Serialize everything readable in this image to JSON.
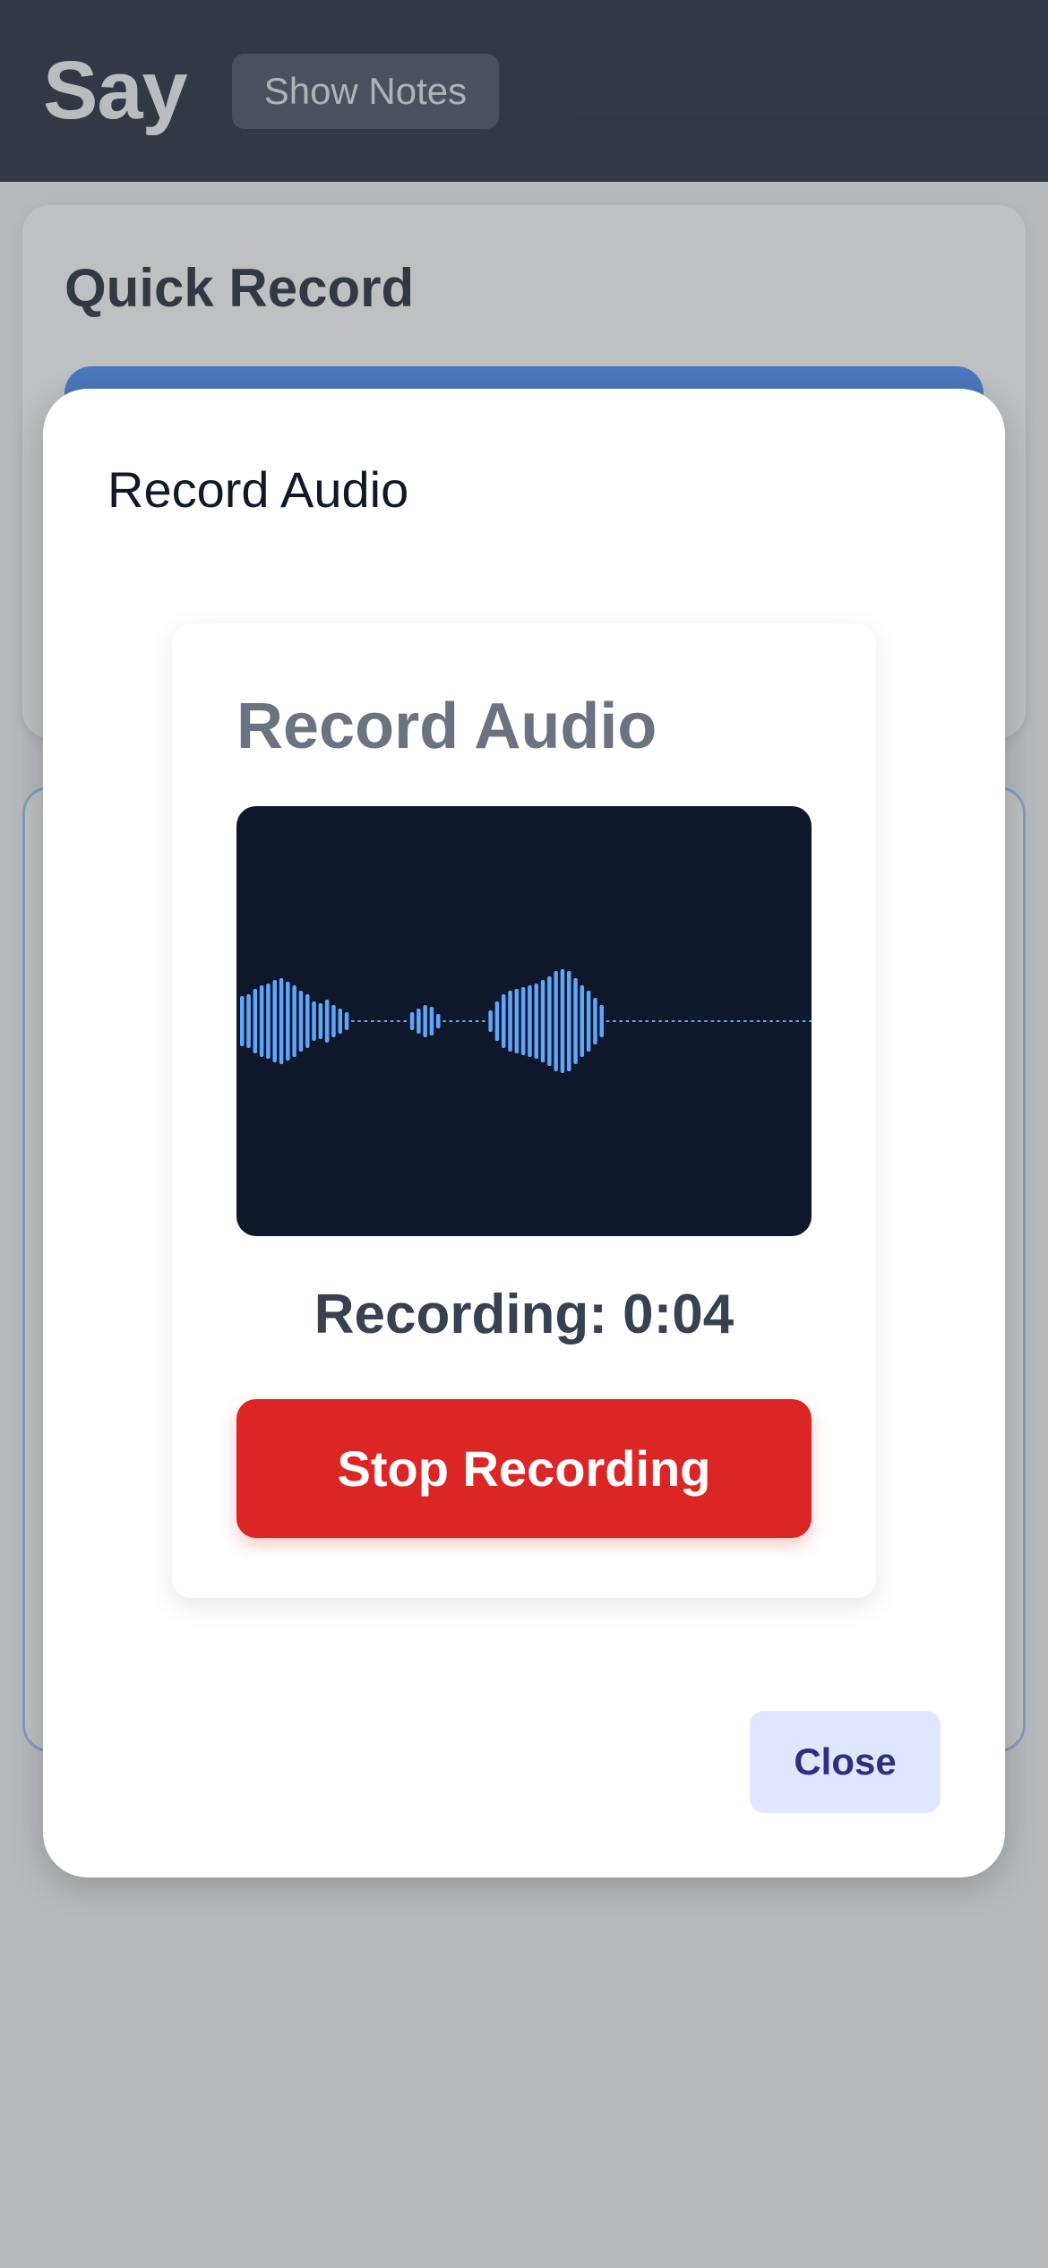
{
  "header": {
    "app_title": "Say",
    "show_notes_label": "Show Notes"
  },
  "quick_record": {
    "title": "Quick Record"
  },
  "modal": {
    "title": "Record Audio",
    "close_label": "Close",
    "recorder": {
      "title": "Record Audio",
      "status": "Recording: 0:04",
      "stop_label": "Stop Recording"
    }
  },
  "colors": {
    "header_bg": "#111827",
    "accent_blue": "#3b82f6",
    "stop_red": "#dc2626",
    "waveform_bg": "#0f172a",
    "waveform_bar": "#60a5fa",
    "close_bg": "#e0e7ff"
  },
  "icons": [
    "waveform-visualizer"
  ]
}
